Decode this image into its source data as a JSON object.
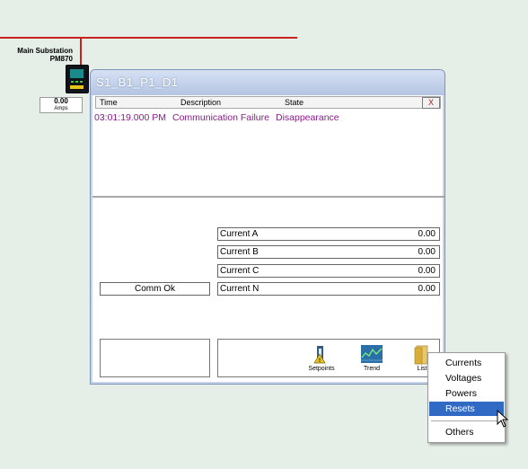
{
  "diagram": {
    "substation_name": "Main Substation",
    "meter_model": "PM870",
    "amps_value": "0.00",
    "amps_unit": "Amps"
  },
  "window": {
    "title": "S1_B1_P1_D1",
    "close_label": "X",
    "event_columns": [
      "Time",
      "Description",
      "State"
    ],
    "events": [
      {
        "time": "03:01:19.000 PM",
        "description": "Communication Failure",
        "state": "Disappearance"
      }
    ],
    "comm_status": "Comm Ok",
    "currents": [
      {
        "label": "Current A",
        "value": "0.00"
      },
      {
        "label": "Current B",
        "value": "0.00"
      },
      {
        "label": "Current C",
        "value": "0.00"
      },
      {
        "label": "Current N",
        "value": "0.00"
      }
    ],
    "tools": [
      {
        "label": "Setpoints",
        "icon": "setpoints-icon"
      },
      {
        "label": "Trend",
        "icon": "trend-icon"
      },
      {
        "label": "List",
        "icon": "folder-icon"
      }
    ]
  },
  "context_menu": {
    "items": [
      "Currents",
      "Voltages",
      "Powers",
      "Resets",
      "Others"
    ],
    "selected": "Resets"
  },
  "colors": {
    "bus_line": "#cc1f1f",
    "event_text": "#8a1a8a",
    "menu_highlight": "#316ac5",
    "window_frame": "#c9d5ea"
  }
}
